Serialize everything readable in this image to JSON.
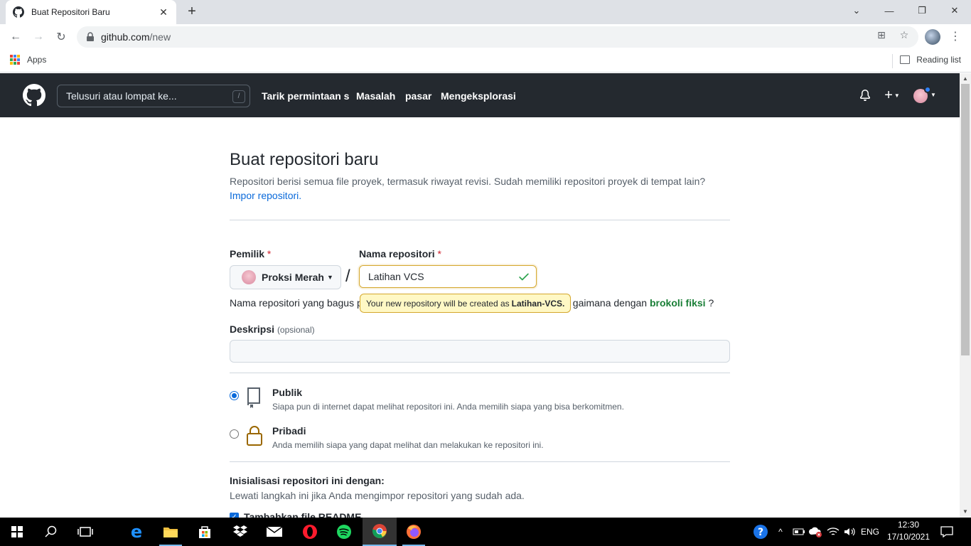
{
  "browser": {
    "tab_title": "Buat Repositori Baru",
    "new_tab_icon": "+",
    "url_host": "github.com",
    "url_path": "/new",
    "bookmarks": {
      "apps_label": "Apps",
      "reading_list_label": "Reading list"
    }
  },
  "github_header": {
    "search_placeholder": "Telusuri atau lompat ke...",
    "search_shortcut": "/",
    "nav": [
      "Tarik permintaan s",
      "Masalah",
      "pasar",
      "Mengeksplorasi"
    ],
    "plus_label": "+"
  },
  "page": {
    "title": "Buat repositori baru",
    "subtitle": "Repositori berisi semua file proyek, termasuk riwayat revisi. Sudah memiliki repositori proyek di tempat lain?",
    "import_link": "Impor repositori.",
    "owner_label": "Pemilik",
    "repo_label": "Nama repositori",
    "required_mark": "*",
    "owner_value": "Proksi Merah",
    "slash": "/",
    "repo_value": "Latihan VCS",
    "help_prefix": "Nama repositori yang bagus p",
    "help_suffix": "gaimana dengan",
    "help_suggestion": "brokoli fiksi",
    "help_end": "?",
    "tooltip_text": "Your new repository will be created as",
    "tooltip_name": "Latihan-VCS.",
    "description_label": "Deskripsi",
    "description_optional": "(opsional)",
    "visibility": [
      {
        "title": "Publik",
        "desc": "Siapa pun di internet dapat melihat repositori ini. Anda memilih siapa yang bisa berkomitmen.",
        "checked": true
      },
      {
        "title": "Pribadi",
        "desc": "Anda memilih siapa yang dapat melihat dan melakukan ke repositori ini.",
        "checked": false
      }
    ],
    "init_title": "Inisialisasi repositori ini dengan:",
    "init_sub": "Lewati langkah ini jika Anda mengimpor repositori yang sudah ada.",
    "readme_label": "Tambahkan file README"
  },
  "taskbar": {
    "language": "ENG",
    "time": "12:30",
    "date": "17/10/2021"
  },
  "colors": {
    "gh_header": "#24292f",
    "accent_blue": "#0969da",
    "valid_green": "#2da44e",
    "tooltip_bg": "#fff8c5"
  }
}
